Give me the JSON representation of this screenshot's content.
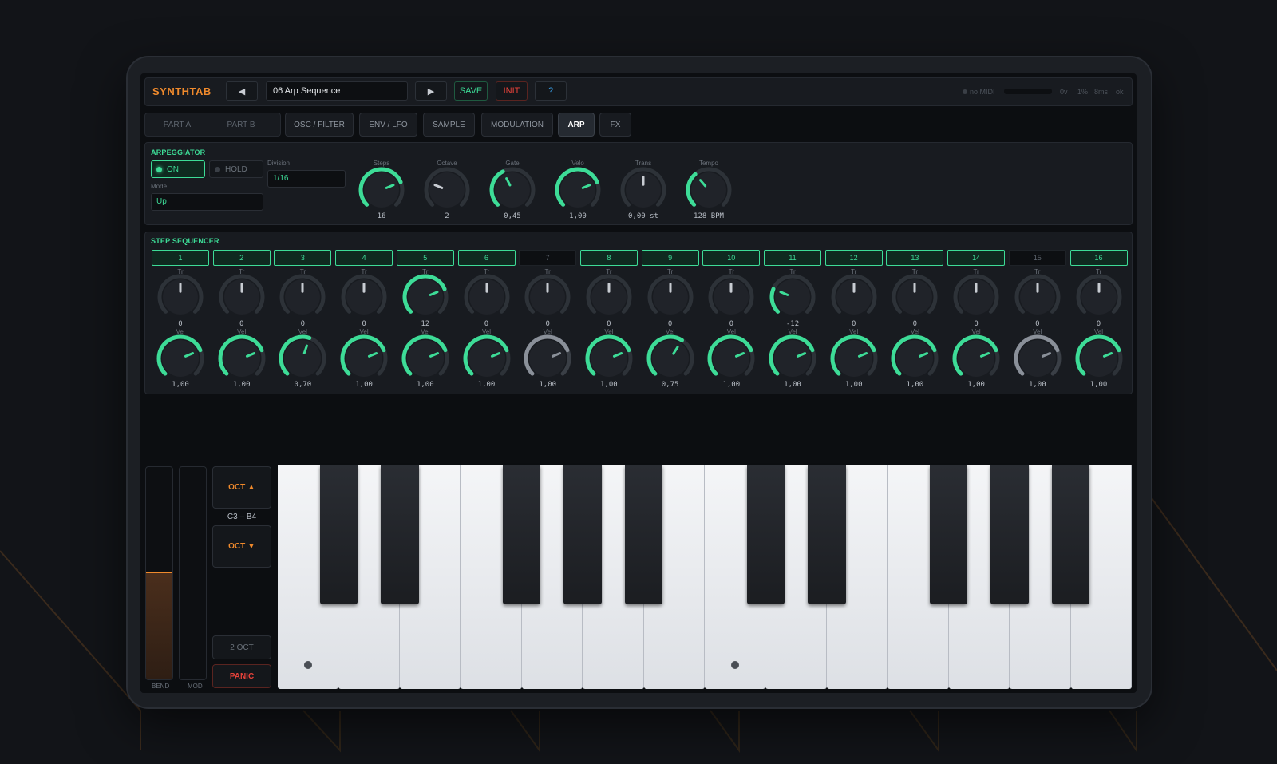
{
  "app": {
    "brand": "SYNTHTAB"
  },
  "toolbar": {
    "prev_label": "◀",
    "preset_name": "06 Arp Sequence",
    "next_label": "▶",
    "save_label": "SAVE",
    "init_label": "INIT",
    "help_label": "?"
  },
  "status": {
    "midi": "no MIDI",
    "voices": "0v",
    "cpu": "1%",
    "latency": "8ms",
    "state": "ok"
  },
  "parts": [
    "PART A",
    "PART B"
  ],
  "tabs": [
    {
      "label": "OSC / FILTER",
      "active": false
    },
    {
      "label": "ENV / LFO",
      "active": false
    },
    {
      "label": "SAMPLE",
      "active": false
    },
    {
      "label": "MODULATION",
      "active": false
    },
    {
      "label": "ARP",
      "active": true
    },
    {
      "label": "FX",
      "active": false
    }
  ],
  "arpeggiator": {
    "title": "ARPEGGIATOR",
    "on_label": "ON",
    "hold_label": "HOLD",
    "division_label": "Division",
    "division_value": "1/16",
    "mode_label": "Mode",
    "mode_value": "Up",
    "knobs": [
      {
        "label": "Steps",
        "value": "16",
        "level": 0.75,
        "color": "#3ddc97"
      },
      {
        "label": "Octave",
        "value": "2",
        "level": 0.25,
        "color": "#2d3238"
      },
      {
        "label": "Gate",
        "value": "0,45",
        "level": 0.4,
        "color": "#3ddc97"
      },
      {
        "label": "Velo",
        "value": "1,00",
        "level": 0.75,
        "color": "#3ddc97"
      },
      {
        "label": "Trans",
        "value": "0,00 st",
        "level": 0.5,
        "color": "#2d3238"
      },
      {
        "label": "Tempo",
        "value": "128 BPM",
        "level": 0.35,
        "color": "#3ddc97"
      }
    ]
  },
  "sequencer": {
    "title": "STEP SEQUENCER",
    "tr_label": "Tr",
    "vel_label": "Vel",
    "steps": [
      {
        "num": "1",
        "on": true,
        "tr": "0",
        "tr_level": 0.5,
        "vel": "1,00",
        "vel_level": 0.75
      },
      {
        "num": "2",
        "on": true,
        "tr": "0",
        "tr_level": 0.5,
        "vel": "1,00",
        "vel_level": 0.75
      },
      {
        "num": "3",
        "on": true,
        "tr": "0",
        "tr_level": 0.5,
        "vel": "0,70",
        "vel_level": 0.57
      },
      {
        "num": "4",
        "on": true,
        "tr": "0",
        "tr_level": 0.5,
        "vel": "1,00",
        "vel_level": 0.75
      },
      {
        "num": "5",
        "on": true,
        "tr": "12",
        "tr_level": 0.75,
        "vel": "1,00",
        "vel_level": 0.75
      },
      {
        "num": "6",
        "on": true,
        "tr": "0",
        "tr_level": 0.5,
        "vel": "1,00",
        "vel_level": 0.75
      },
      {
        "num": "7",
        "on": false,
        "tr": "0",
        "tr_level": 0.5,
        "vel": "1,00",
        "vel_level": 0.75
      },
      {
        "num": "8",
        "on": true,
        "tr": "0",
        "tr_level": 0.5,
        "vel": "1,00",
        "vel_level": 0.75
      },
      {
        "num": "9",
        "on": true,
        "tr": "0",
        "tr_level": 0.5,
        "vel": "0,75",
        "vel_level": 0.62
      },
      {
        "num": "10",
        "on": true,
        "tr": "0",
        "tr_level": 0.5,
        "vel": "1,00",
        "vel_level": 0.75
      },
      {
        "num": "11",
        "on": true,
        "tr": "-12",
        "tr_level": 0.25,
        "vel": "1,00",
        "vel_level": 0.75
      },
      {
        "num": "12",
        "on": true,
        "tr": "0",
        "tr_level": 0.5,
        "vel": "1,00",
        "vel_level": 0.75
      },
      {
        "num": "13",
        "on": true,
        "tr": "0",
        "tr_level": 0.5,
        "vel": "1,00",
        "vel_level": 0.75
      },
      {
        "num": "14",
        "on": true,
        "tr": "0",
        "tr_level": 0.5,
        "vel": "1,00",
        "vel_level": 0.75
      },
      {
        "num": "15",
        "on": false,
        "tr": "0",
        "tr_level": 0.5,
        "vel": "1,00",
        "vel_level": 0.75
      },
      {
        "num": "16",
        "on": true,
        "tr": "0",
        "tr_level": 0.5,
        "vel": "1,00",
        "vel_level": 0.75
      }
    ]
  },
  "keyboard": {
    "oct_up": "OCT ▲",
    "range": "C3 – B4",
    "oct_down": "OCT ▼",
    "span": "2 OCT",
    "panic": "PANIC",
    "bend_label": "BEND",
    "mod_label": "MOD",
    "bend_level": 0.5,
    "mod_level": 0,
    "white_keys": 14
  },
  "colors": {
    "accent": "#3ddc97",
    "brand": "#f08a2c",
    "alert": "#e8423a",
    "help": "#3aa0e8"
  }
}
